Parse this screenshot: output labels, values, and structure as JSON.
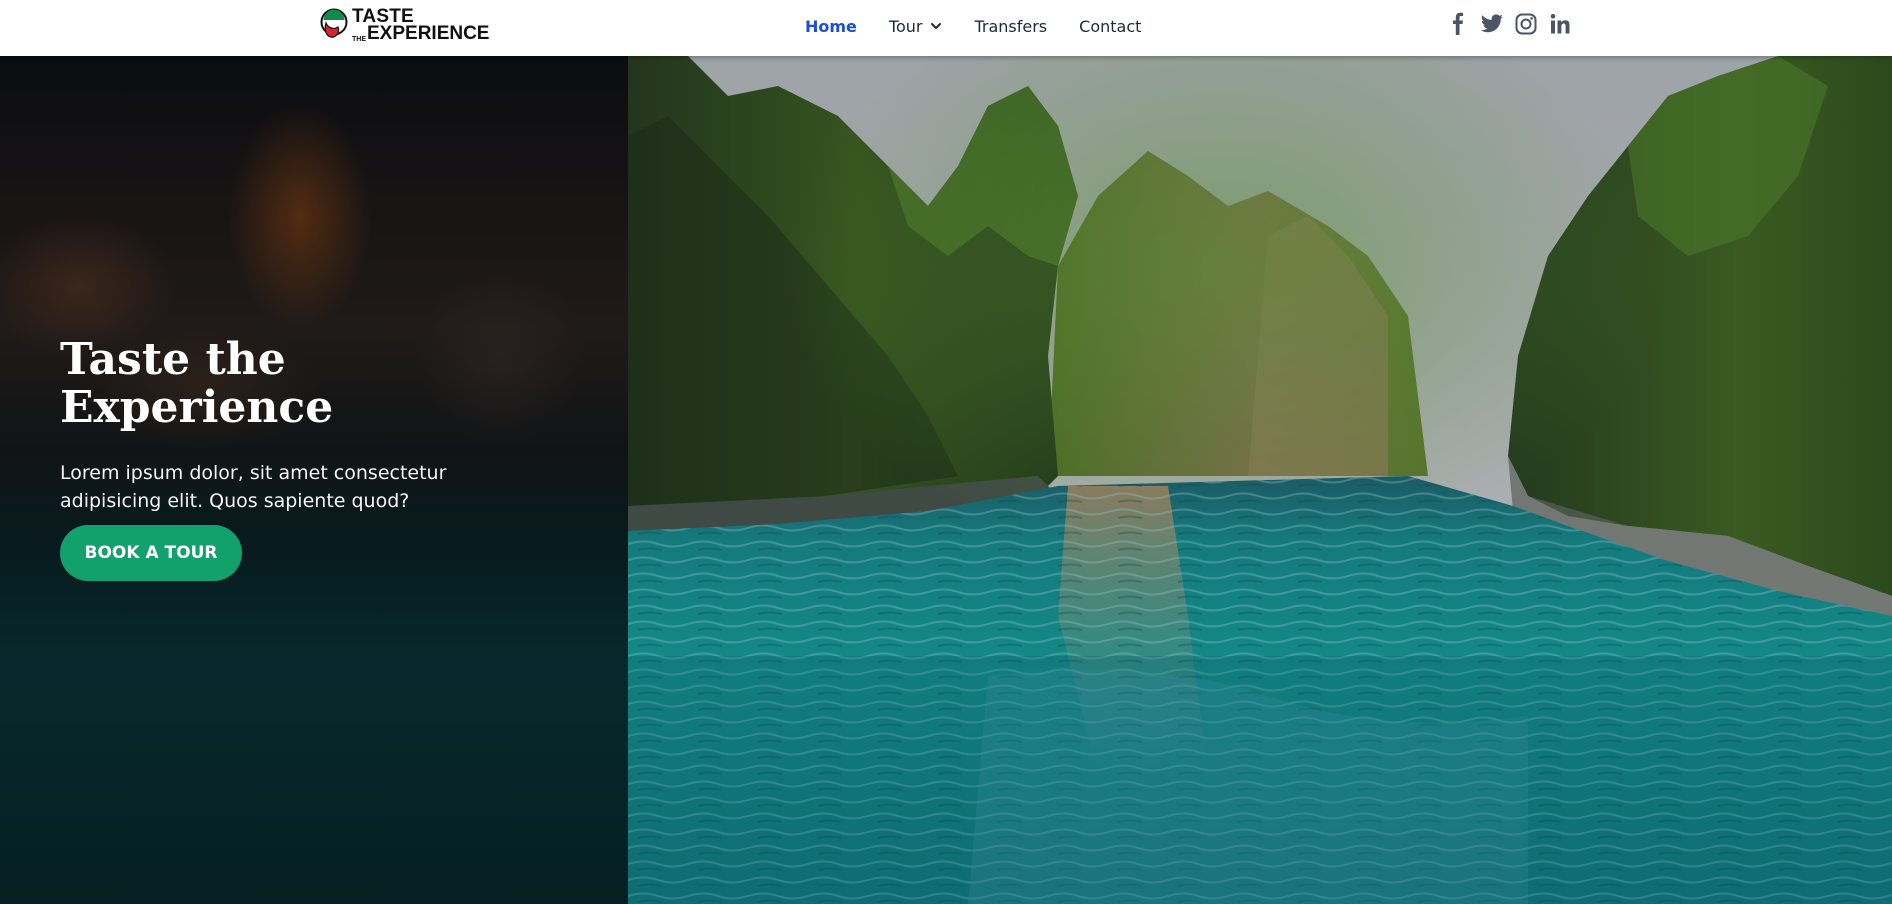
{
  "brand": {
    "logo_line1": "TASTE",
    "logo_line2_small": "THE",
    "logo_line2": "EXPERIENCE",
    "colors": {
      "green": "#0f8a4a",
      "red": "#d9232e",
      "black": "#111111"
    }
  },
  "nav": {
    "items": [
      {
        "label": "Home",
        "active": true
      },
      {
        "label": "Tour",
        "has_dropdown": true
      },
      {
        "label": "Transfers"
      },
      {
        "label": "Contact"
      }
    ],
    "active_color": "#1d4ed8"
  },
  "social": {
    "icons": [
      "facebook-icon",
      "twitter-icon",
      "instagram-icon",
      "linkedin-icon"
    ]
  },
  "hero": {
    "title_line1": "Taste the",
    "title_line2": "Experience",
    "subtitle": "Lorem ipsum dolor, sit amet consectetur adipisicing elit. Quos sapiente quod?",
    "cta_label": "BOOK A TOUR",
    "cta_color": "#12a06c",
    "image_subject": "limestone cliffs lagoon turquoise water"
  }
}
